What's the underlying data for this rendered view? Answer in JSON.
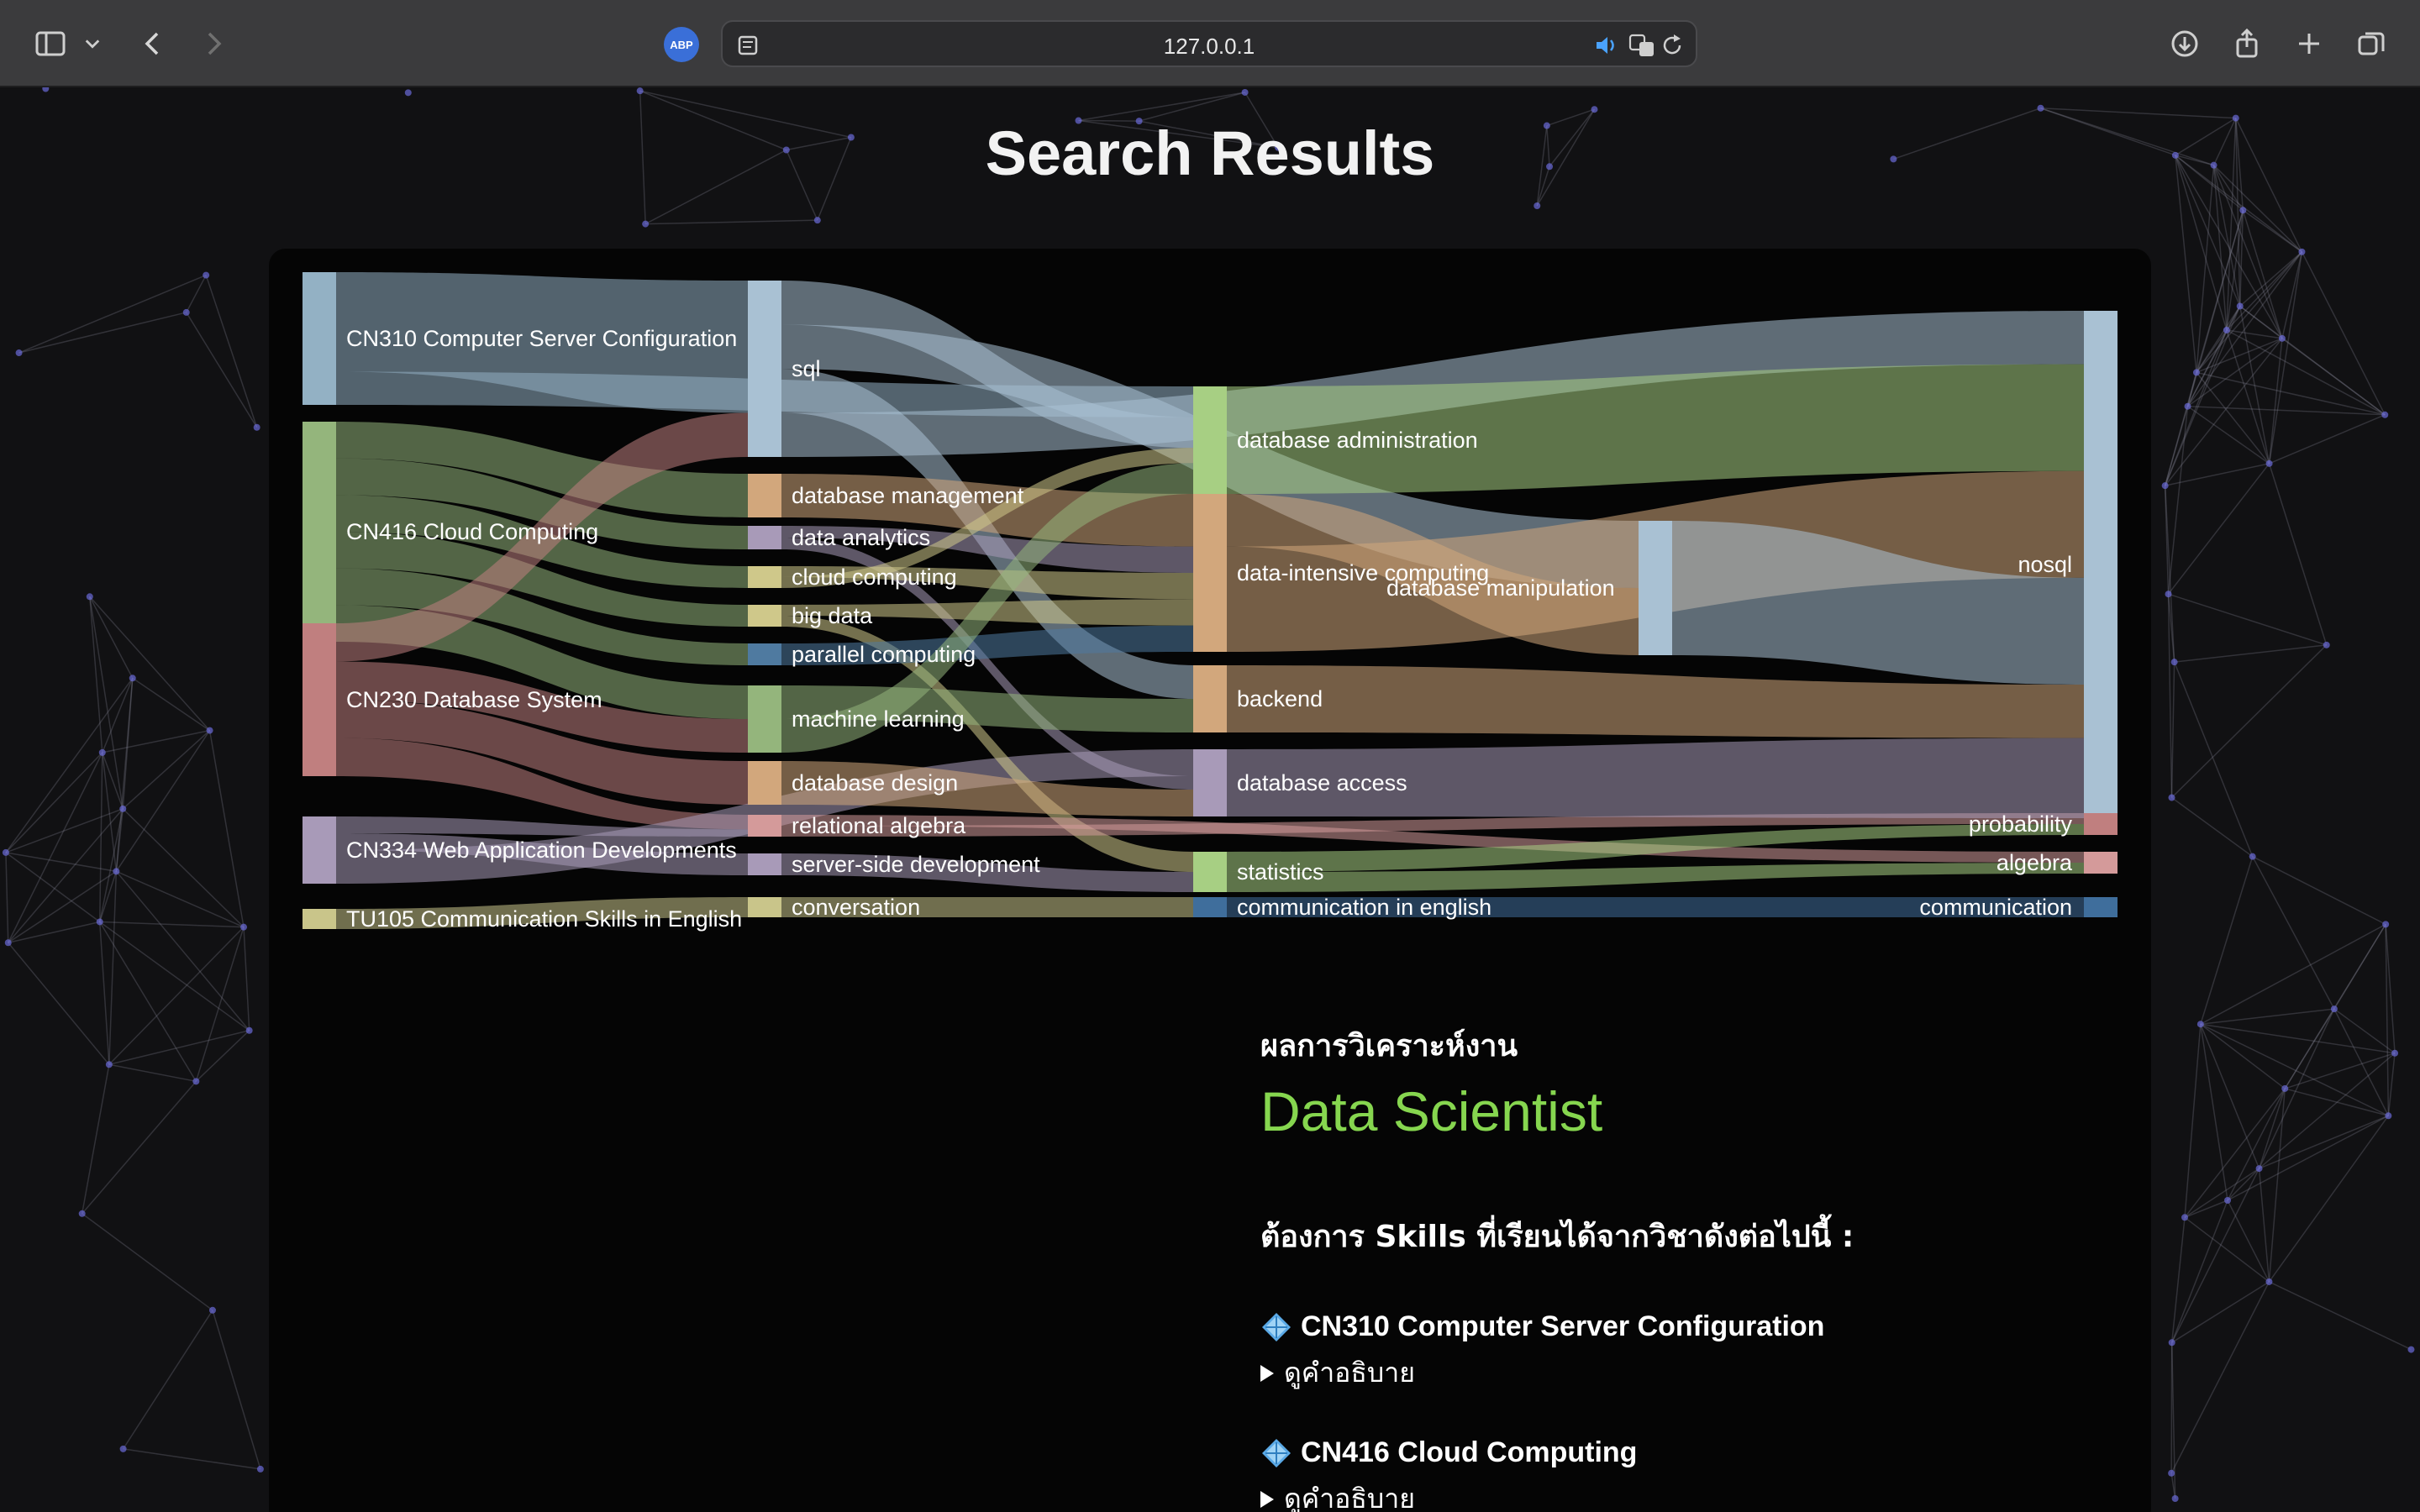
{
  "browser": {
    "url": "127.0.0.1",
    "icons": [
      "sidebar-icon",
      "chevron-down-icon",
      "back-icon",
      "forward-icon",
      "adblock-icon",
      "reader-icon",
      "speaker-icon",
      "translate-icon",
      "reload-icon",
      "download-icon",
      "share-icon",
      "new-tab-icon",
      "tabs-overview-icon"
    ],
    "abp_label": "ABP"
  },
  "page": {
    "title": "Search Results"
  },
  "sankey": {
    "courses": [
      {
        "label": "CN310 Computer Server Configuration",
        "color": "#93b1c4"
      },
      {
        "label": "CN416 Cloud Computing",
        "color": "#94b57c"
      },
      {
        "label": "CN230 Database System",
        "color": "#c07f7f"
      },
      {
        "label": "CN334 Web Application Developments",
        "color": "#a89ab8"
      },
      {
        "label": "TU105 Communication Skills in English",
        "color": "#c9c58a"
      }
    ],
    "topics": [
      {
        "label": "sql",
        "color": "#a9c1d3"
      },
      {
        "label": "database management",
        "color": "#d2a77c"
      },
      {
        "label": "data analytics",
        "color": "#a89ab8"
      },
      {
        "label": "cloud computing",
        "color": "#cfc88a"
      },
      {
        "label": "big data",
        "color": "#cfc88a"
      },
      {
        "label": "parallel computing",
        "color": "#4f7aa0"
      },
      {
        "label": "machine learning",
        "color": "#94b57c"
      },
      {
        "label": "database design",
        "color": "#d2a77c"
      },
      {
        "label": "relational algebra",
        "color": "#d49a9a"
      },
      {
        "label": "server-side development",
        "color": "#a89ab8"
      },
      {
        "label": "conversation",
        "color": "#c9c58a"
      }
    ],
    "skills": [
      {
        "label": "database administration",
        "color": "#a7cf83"
      },
      {
        "label": "data-intensive computing",
        "color": "#d2a77c"
      },
      {
        "label": "database manipulation",
        "color": "#a9c1d3"
      },
      {
        "label": "backend",
        "color": "#d2a77c"
      },
      {
        "label": "database access",
        "color": "#a89ab8"
      },
      {
        "label": "statistics",
        "color": "#a7cf83"
      },
      {
        "label": "communication in english",
        "color": "#3f6e9c"
      }
    ],
    "outcomes": [
      {
        "label": "nosql",
        "color": "#a9c1d3"
      },
      {
        "label": "probability",
        "color": "#c07f7f"
      },
      {
        "label": "algebra",
        "color": "#d49a9a"
      },
      {
        "label": "communication",
        "color": "#3f6e9c"
      }
    ],
    "links": [
      {
        "from": "CN310 Computer Server Configuration",
        "to": "sql",
        "value": 3
      },
      {
        "from": "CN310 Computer Server Configuration",
        "to": "database administration",
        "value": 1
      },
      {
        "from": "CN416 Cloud Computing",
        "to": "database management",
        "value": 1
      },
      {
        "from": "CN416 Cloud Computing",
        "to": "data analytics",
        "value": 1
      },
      {
        "from": "CN416 Cloud Computing",
        "to": "cloud computing",
        "value": 1
      },
      {
        "from": "CN416 Cloud Computing",
        "to": "big data",
        "value": 1
      },
      {
        "from": "CN416 Cloud Computing",
        "to": "parallel computing",
        "value": 1
      },
      {
        "from": "CN416 Cloud Computing",
        "to": "machine learning",
        "value": 1
      },
      {
        "from": "CN230 Database System",
        "to": "sql",
        "value": 1
      },
      {
        "from": "CN230 Database System",
        "to": "machine learning",
        "value": 1
      },
      {
        "from": "CN230 Database System",
        "to": "database design",
        "value": 1
      },
      {
        "from": "CN230 Database System",
        "to": "relational algebra",
        "value": 1
      },
      {
        "from": "CN334 Web Application Developments",
        "to": "relational algebra",
        "value": 0.5
      },
      {
        "from": "CN334 Web Application Developments",
        "to": "server-side development",
        "value": 0.5
      },
      {
        "from": "CN334 Web Application Developments",
        "to": "database access",
        "value": 1
      },
      {
        "from": "TU105 Communication Skills in English",
        "to": "conversation",
        "value": 0.5
      },
      {
        "from": "sql",
        "to": "database administration",
        "value": 1
      },
      {
        "from": "sql",
        "to": "database manipulation",
        "value": 1
      },
      {
        "from": "sql",
        "to": "backend",
        "value": 1
      },
      {
        "from": "sql",
        "to": "nosql",
        "value": 1
      },
      {
        "from": "database management",
        "to": "data-intensive computing",
        "value": 1
      },
      {
        "from": "data analytics",
        "to": "data-intensive computing",
        "value": 0.5
      },
      {
        "from": "data analytics",
        "to": "database access",
        "value": 0.5
      },
      {
        "from": "cloud computing",
        "to": "data-intensive computing",
        "value": 0.5
      },
      {
        "from": "cloud computing",
        "to": "database administration",
        "value": 0.5
      },
      {
        "from": "big data",
        "to": "data-intensive computing",
        "value": 0.5
      },
      {
        "from": "big data",
        "to": "statistics",
        "value": 0.5
      },
      {
        "from": "parallel computing",
        "to": "data-intensive computing",
        "value": 0.5
      },
      {
        "from": "machine learning",
        "to": "backend",
        "value": 1
      },
      {
        "from": "machine learning",
        "to": "database administration",
        "value": 1
      },
      {
        "from": "database design",
        "to": "database access",
        "value": 1
      },
      {
        "from": "relational algebra",
        "to": "algebra",
        "value": 0.5
      },
      {
        "from": "relational algebra",
        "to": "probability",
        "value": 0.5
      },
      {
        "from": "server-side development",
        "to": "statistics",
        "value": 0.5
      },
      {
        "from": "conversation",
        "to": "communication in english",
        "value": 0.5
      },
      {
        "from": "database administration",
        "to": "nosql",
        "value": 2
      },
      {
        "from": "data-intensive computing",
        "to": "database manipulation",
        "value": 1
      },
      {
        "from": "data-intensive computing",
        "to": "nosql",
        "value": 2
      },
      {
        "from": "database manipulation",
        "to": "nosql",
        "value": 2
      },
      {
        "from": "backend",
        "to": "nosql",
        "value": 1
      },
      {
        "from": "database access",
        "to": "nosql",
        "value": 1.5
      },
      {
        "from": "statistics",
        "to": "probability",
        "value": 0.5
      },
      {
        "from": "statistics",
        "to": "algebra",
        "value": 0.5
      },
      {
        "from": "communication in english",
        "to": "communication",
        "value": 0.5
      }
    ]
  },
  "analysis": {
    "heading": "ผลการวิเคราะห์งาน",
    "job": "Data Scientist",
    "requirement": "ต้องการ Skills ที่เรียนได้จากวิชาดังต่อไปนี้ :",
    "courses": [
      {
        "title": "CN310 Computer Server Configuration",
        "more": "ดูคำอธิบาย",
        "icon": "diamond-icon"
      },
      {
        "title": "CN416 Cloud Computing",
        "more": "ดูคำอธิบาย",
        "icon": "diamond-icon"
      }
    ]
  }
}
